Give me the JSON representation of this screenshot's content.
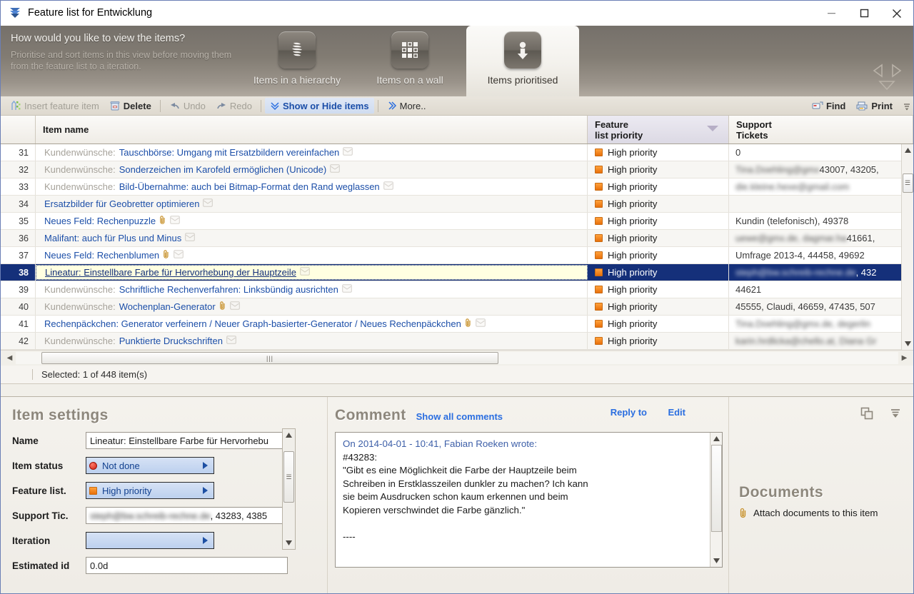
{
  "window": {
    "title": "Feature list for Entwicklung",
    "minimize": "—",
    "maximize": "□",
    "close": "✕"
  },
  "view_header": {
    "question": "How would you like to view the items?",
    "description": "Prioritise and sort items in this view before moving them from the feature list to a iteration.",
    "tabs": [
      {
        "label": "Items in a hierarchy",
        "icon": "hierarchy-icon",
        "active": false
      },
      {
        "label": "Items on a wall",
        "icon": "wall-icon",
        "active": false
      },
      {
        "label": "Items prioritised",
        "icon": "prioritised-icon",
        "active": true
      }
    ]
  },
  "toolbar": {
    "left": [
      {
        "label": "Insert feature item",
        "icon": "insert-item-icon",
        "state": "disabled"
      },
      {
        "label": "Delete",
        "icon": "delete-icon",
        "state": "normal"
      },
      {
        "label": "Undo",
        "icon": "undo-icon",
        "state": "disabled"
      },
      {
        "label": "Redo",
        "icon": "redo-icon",
        "state": "disabled"
      },
      {
        "label": "Show or Hide items",
        "icon": "chevron-double-down-icon",
        "state": "link"
      },
      {
        "label": "More..",
        "icon": "chevron-double-right-icon",
        "state": "normal"
      }
    ],
    "right": [
      {
        "label": "Find",
        "icon": "find-icon"
      },
      {
        "label": "Print",
        "icon": "print-icon"
      }
    ]
  },
  "grid": {
    "columns": [
      {
        "key": "num",
        "label": ""
      },
      {
        "key": "name",
        "label": "Item name"
      },
      {
        "key": "priority",
        "label": "Feature\nlist priority",
        "line1": "Feature",
        "line2": "list priority",
        "sorted": true
      },
      {
        "key": "tickets",
        "label": "Support\nTickets",
        "line1": "Support",
        "line2": "Tickets"
      }
    ],
    "rows": [
      {
        "num": "31",
        "prefix": "Kundenwünsche:",
        "name": "Tauschbörse: Umgang mit Ersatzbildern vereinfachen",
        "clip": false,
        "comment": true,
        "priority": "High priority",
        "tickets": "0",
        "tickets_blurred": "",
        "selected": false
      },
      {
        "num": "32",
        "prefix": "Kundenwünsche:",
        "name": "Sonderzeichen im Karofeld ermöglichen (Unicode)",
        "clip": false,
        "comment": true,
        "priority": "High priority",
        "tickets": "43007, 43205,",
        "tickets_blurred": "Tina.Doehling@gmx",
        "selected": false
      },
      {
        "num": "33",
        "prefix": "Kundenwünsche:",
        "name": "Bild-Übernahme: auch bei Bitmap-Format den Rand weglassen",
        "clip": false,
        "comment": true,
        "priority": "High priority",
        "tickets": "",
        "tickets_blurred": "die.kleine.hexe@gmail.com",
        "selected": false
      },
      {
        "num": "34",
        "prefix": "",
        "name": "Ersatzbilder für Geobretter optimieren",
        "clip": false,
        "comment": true,
        "priority": "High priority",
        "tickets": "",
        "tickets_blurred": "",
        "selected": false
      },
      {
        "num": "35",
        "prefix": "",
        "name": "Neues Feld: Rechenpuzzle",
        "clip": true,
        "comment": true,
        "priority": "High priority",
        "tickets": "Kundin (telefonisch), 49378",
        "tickets_blurred": "",
        "selected": false
      },
      {
        "num": "36",
        "prefix": "",
        "name": "Malifant: auch für Plus und Minus",
        "clip": false,
        "comment": true,
        "priority": "High priority",
        "tickets": "41661,",
        "tickets_blurred": "uewe@gmx.de, dagmar.ha",
        "selected": false
      },
      {
        "num": "37",
        "prefix": "",
        "name": "Neues Feld: Rechenblumen",
        "clip": true,
        "comment": true,
        "priority": "High priority",
        "tickets": "Umfrage 2013-4, 44458, 49692",
        "tickets_blurred": "",
        "selected": false
      },
      {
        "num": "38",
        "prefix": "",
        "name": "Lineatur: Einstellbare Farbe für Hervorhebung der Hauptzeile",
        "clip": false,
        "comment": true,
        "priority": "High priority",
        "tickets": ", 432",
        "tickets_blurred": "steph@bw.schreib-rechne.de",
        "selected": true
      },
      {
        "num": "39",
        "prefix": "Kundenwünsche:",
        "name": "Schriftliche Rechenverfahren: Linksbündig ausrichten",
        "clip": false,
        "comment": true,
        "priority": "High priority",
        "tickets": "44621",
        "tickets_blurred": "",
        "selected": false
      },
      {
        "num": "40",
        "prefix": "Kundenwünsche:",
        "name": "Wochenplan-Generator",
        "clip": true,
        "comment": true,
        "priority": "High priority",
        "tickets": "45555, Claudi, 46659, 47435, 507",
        "tickets_blurred": "",
        "selected": false
      },
      {
        "num": "41",
        "prefix": "",
        "name": "Rechenpäckchen: Generator verfeinern / Neuer Graph-basierter-Generator / Neues Rechenpäckchen",
        "clip": true,
        "comment": true,
        "priority": "High priority",
        "tickets": "",
        "tickets_blurred": "Tina.Doehling@gmx.de, degerlin",
        "selected": false
      },
      {
        "num": "42",
        "prefix": "Kundenwünsche:",
        "name": "Punktierte Druckschriften",
        "clip": false,
        "comment": true,
        "priority": "High priority",
        "tickets": "",
        "tickets_blurred": "karin.hrdlicka@chello.at, Diana Gr",
        "selected": false
      }
    ]
  },
  "status": {
    "text": "Selected: 1 of 448 item(s)"
  },
  "item_settings": {
    "title": "Item settings",
    "fields": [
      {
        "label": "Name",
        "type": "text",
        "value": "Lineatur: Einstellbare Farbe für Hervorhebu"
      },
      {
        "label": "Item status",
        "type": "dropdown",
        "value": "Not done",
        "marker": "red-dot"
      },
      {
        "label": "Feature list.",
        "type": "dropdown",
        "value": "High priority",
        "marker": "orange-square"
      },
      {
        "label": "Support Tic.",
        "type": "text",
        "value": ", 43283, 4385",
        "blurred": "steph@bw.schreib-rechne.de"
      },
      {
        "label": "Iteration",
        "type": "dropdown",
        "value": "",
        "marker": ""
      },
      {
        "label": "Estimated id",
        "type": "text",
        "value": "0.0d"
      }
    ]
  },
  "comment": {
    "title": "Comment",
    "show_all": "Show all comments",
    "reply_to": "Reply to",
    "edit": "Edit",
    "author_line": "On 2014-04-01 - 10:41, Fabian Roeken wrote:",
    "body": "#43283:\n\"Gibt es eine Möglichkeit die Farbe der Hauptzeile beim\nSchreiben in Erstklasszeilen dunkler zu machen? Ich kann\nsie beim Ausdrucken schon kaum erkennen und beim\nKopieren verschwindet die Farbe gänzlich.\"\n\n----"
  },
  "documents": {
    "title": "Documents",
    "attach_label": "Attach documents to this item"
  },
  "colors": {
    "accent_blue": "#1b4ea8",
    "selection_navy": "#15307a",
    "selection_cream": "#ffffe1",
    "priority_orange": "#e8700c",
    "link_blue": "#2a6ee0",
    "header_band": "#827c73"
  }
}
